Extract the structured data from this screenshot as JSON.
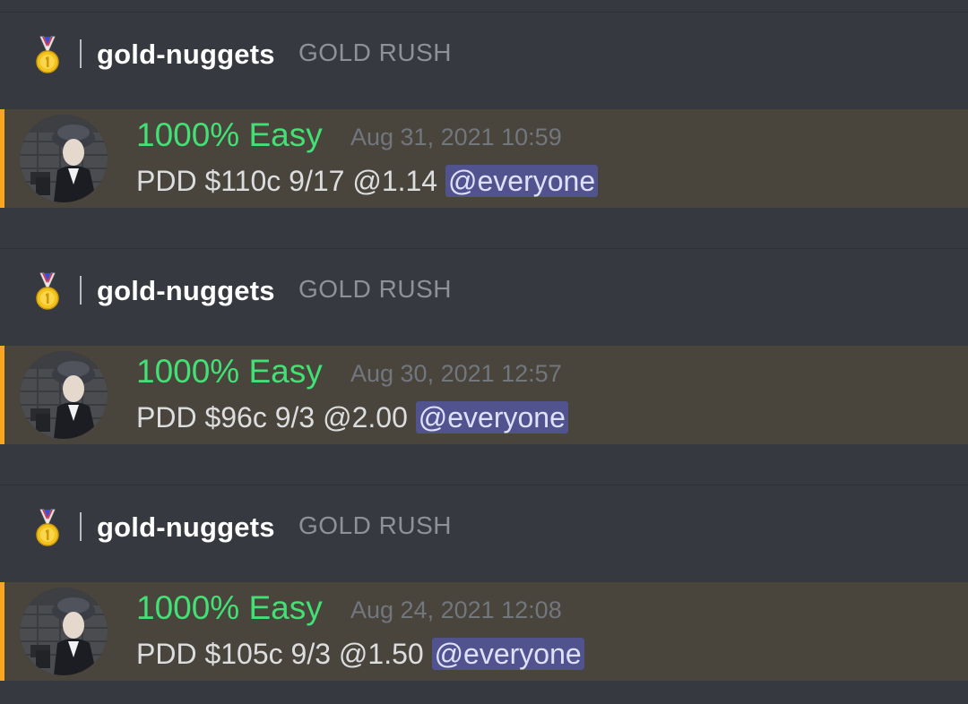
{
  "colors": {
    "background": "#36393f",
    "highlight_bg": "#49443c",
    "highlight_accent": "#faa61a",
    "author_color": "#43e075",
    "mention_bg": "#5865f2"
  },
  "posts": [
    {
      "channel": {
        "icon": "medal-icon",
        "name": "gold-nuggets",
        "server": "GOLD RUSH"
      },
      "message": {
        "avatar": "avatar-man-flat-cap",
        "author": "1000% Easy",
        "timestamp": "Aug 31, 2021 10:59",
        "text": "PDD $110c 9/17 @1.14",
        "mention": "@everyone"
      }
    },
    {
      "channel": {
        "icon": "medal-icon",
        "name": "gold-nuggets",
        "server": "GOLD RUSH"
      },
      "message": {
        "avatar": "avatar-man-flat-cap",
        "author": "1000% Easy",
        "timestamp": "Aug 30, 2021 12:57",
        "text": "PDD $96c 9/3 @2.00",
        "mention": "@everyone"
      }
    },
    {
      "channel": {
        "icon": "medal-icon",
        "name": "gold-nuggets",
        "server": "GOLD RUSH"
      },
      "message": {
        "avatar": "avatar-man-flat-cap",
        "author": "1000% Easy",
        "timestamp": "Aug 24, 2021 12:08",
        "text": "PDD $105c 9/3 @1.50",
        "mention": "@everyone"
      }
    }
  ]
}
